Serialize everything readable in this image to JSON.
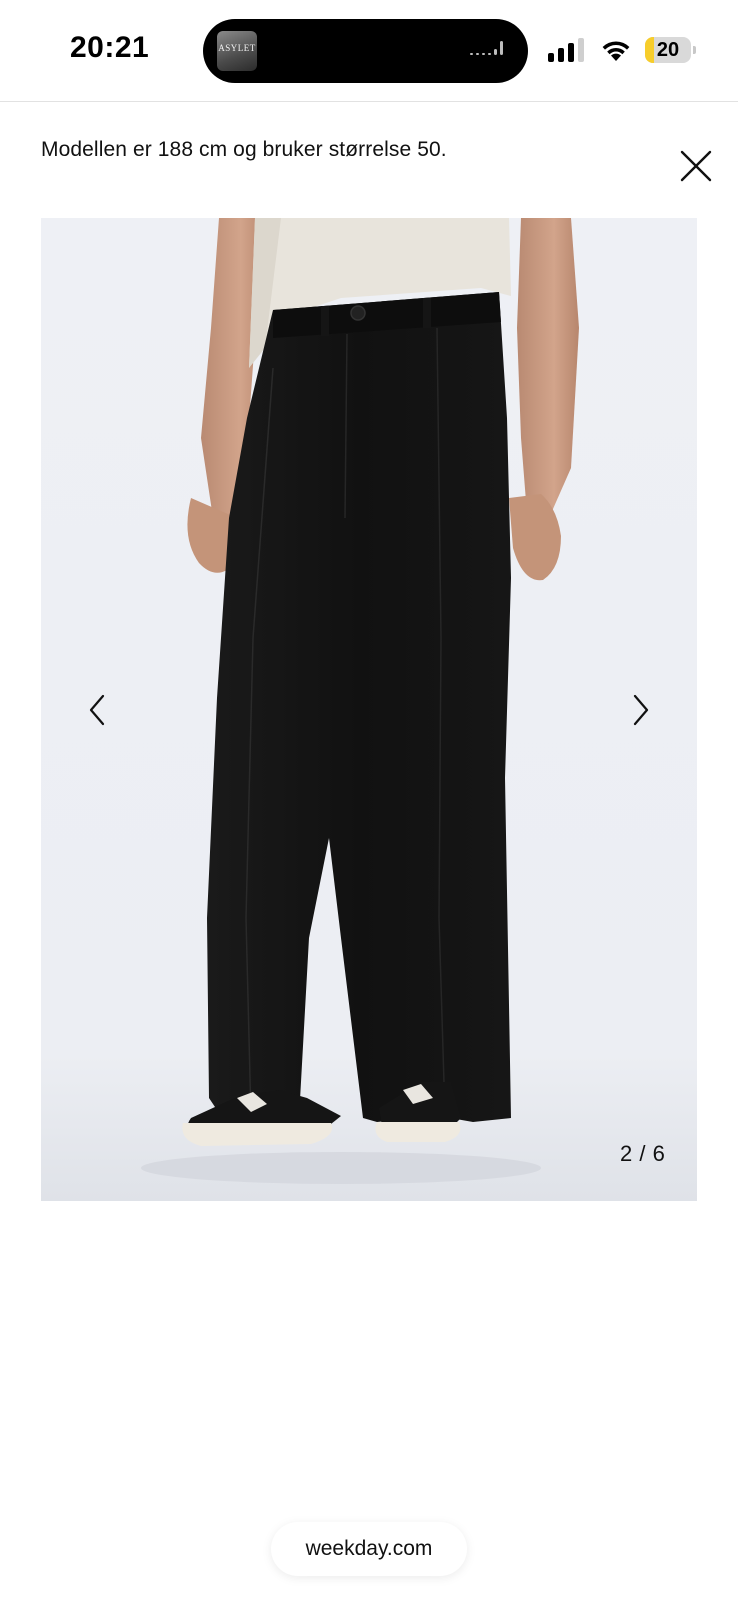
{
  "status_bar": {
    "time": "20:21",
    "battery_level": "20",
    "battery_fraction": 0.2,
    "battery_color": "#f7cd2b",
    "icons": [
      "cellular-signal-icon",
      "wifi-icon",
      "battery-icon"
    ]
  },
  "now_playing": {
    "album_art_text": "ASYLET"
  },
  "header": {
    "caption": "Modellen er 188 cm og bruker størrelse 50.",
    "close_icon": "close-icon"
  },
  "gallery": {
    "image_subject": "product-photo-black-wide-trousers",
    "counter": "2 / 6",
    "prev_icon": "chevron-left-icon",
    "next_icon": "chevron-right-icon",
    "background_color": "#eef0f4"
  },
  "browser": {
    "url": "weekday.com"
  }
}
